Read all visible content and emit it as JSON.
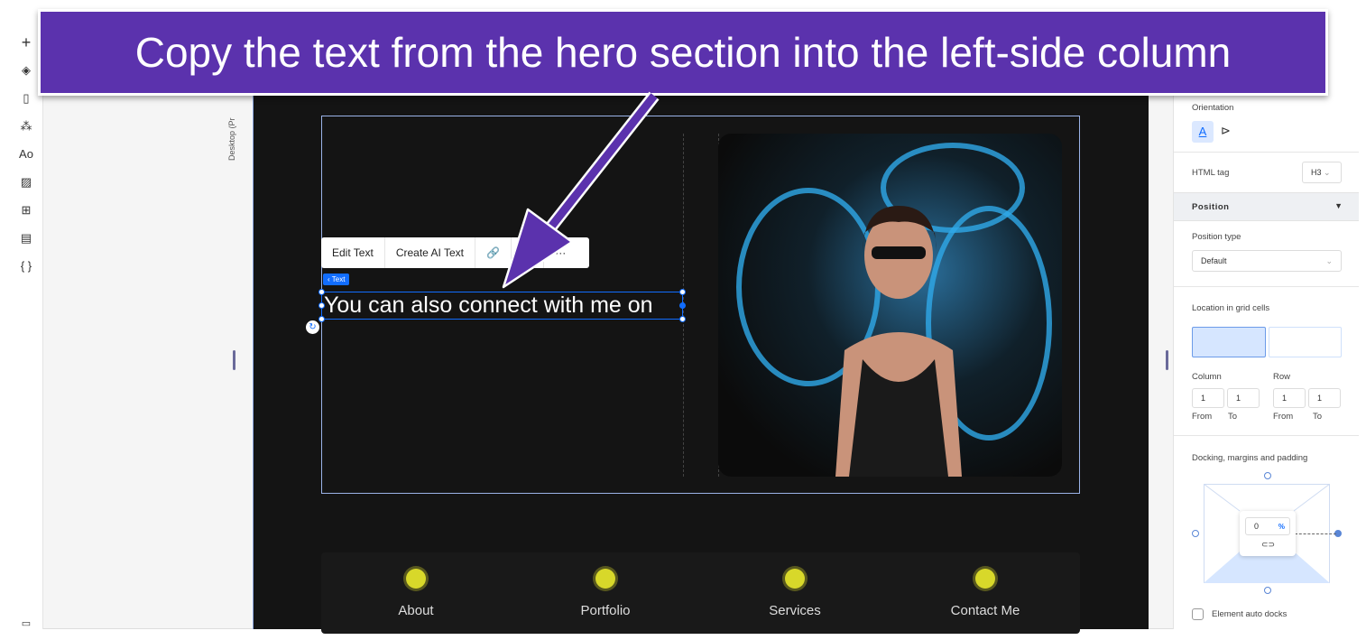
{
  "instruction": "Copy the text from the hero section into the left-side column",
  "left_toolbar": [
    "plus-icon",
    "layers-icon",
    "page-icon",
    "connect-icon",
    "theme-icon",
    "image-icon",
    "apps-icon",
    "table-icon",
    "code-icon"
  ],
  "device_label": "Desktop (Pr",
  "text_toolbar": {
    "edit": "Edit Text",
    "ai": "Create AI Text",
    "more": "···"
  },
  "selection_tag": "‹ Text",
  "hero_text": "You can also connect with me on",
  "nav": [
    "About",
    "Portfolio",
    "Services",
    "Contact Me"
  ],
  "panel": {
    "orientation": "Orientation",
    "html_tag_label": "HTML tag",
    "html_tag": "H3",
    "position": "Position",
    "position_type_label": "Position type",
    "position_type": "Default",
    "grid_label": "Location in grid cells",
    "column": "Column",
    "row": "Row",
    "from": "From",
    "to": "To",
    "col_from": "1",
    "col_to": "1",
    "row_from": "1",
    "row_to": "1",
    "docking": "Docking, margins and padding",
    "margin_value": "0",
    "margin_unit": "%",
    "auto_docks": "Element auto docks"
  },
  "colors": {
    "accent": "#116dff",
    "banner": "#5b32ad",
    "canvas": "#141414",
    "nav_flower": "#d8d82a"
  }
}
